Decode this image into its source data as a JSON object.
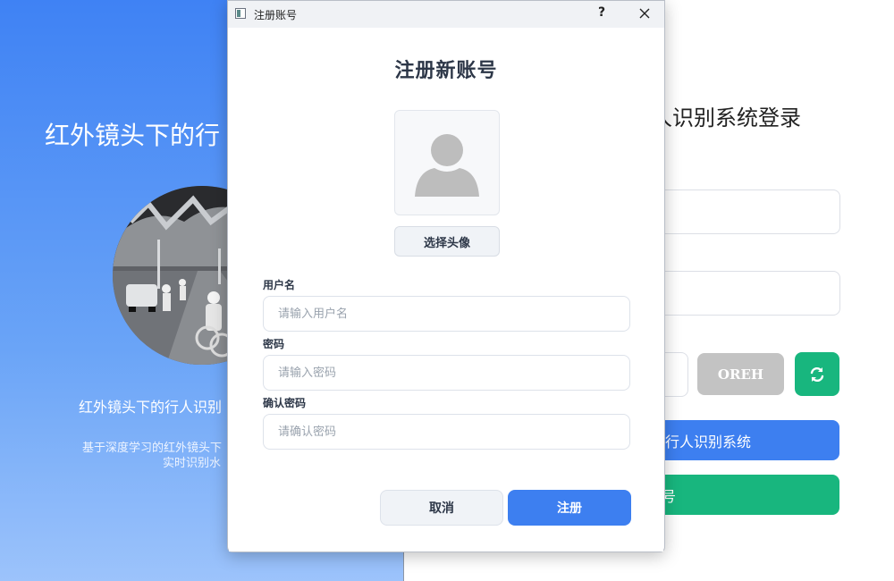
{
  "background_window": {
    "left": {
      "title": "红外镜头下的行",
      "subtitle": "红外镜头下的行人识别",
      "description_line1": "基于深度学习的红外镜头下",
      "description_line2": "实时识别水",
      "gradient_top": "#3f82f4",
      "gradient_bottom": "#9cc3fb"
    },
    "right": {
      "title": "人识别系统登录",
      "captcha_text": "OREH",
      "refresh_icon": "refresh-icon",
      "login_button_label": "行人识别系统",
      "register_button_label": "号",
      "accent_blue": "#3d7ff0",
      "accent_green": "#18b67e"
    }
  },
  "dialog": {
    "window_title": "注册账号",
    "help_label": "?",
    "heading": "注册新账号",
    "avatar_icon": "user-silhouette-icon",
    "choose_avatar_label": "选择头像",
    "fields": {
      "username": {
        "label": "用户名",
        "placeholder": "请输入用户名",
        "value": ""
      },
      "password": {
        "label": "密码",
        "placeholder": "请输入密码",
        "value": ""
      },
      "confirm": {
        "label": "确认密码",
        "placeholder": "请确认密码",
        "value": ""
      }
    },
    "cancel_label": "取消",
    "submit_label": "注册",
    "primary_color": "#3d7ff0"
  }
}
